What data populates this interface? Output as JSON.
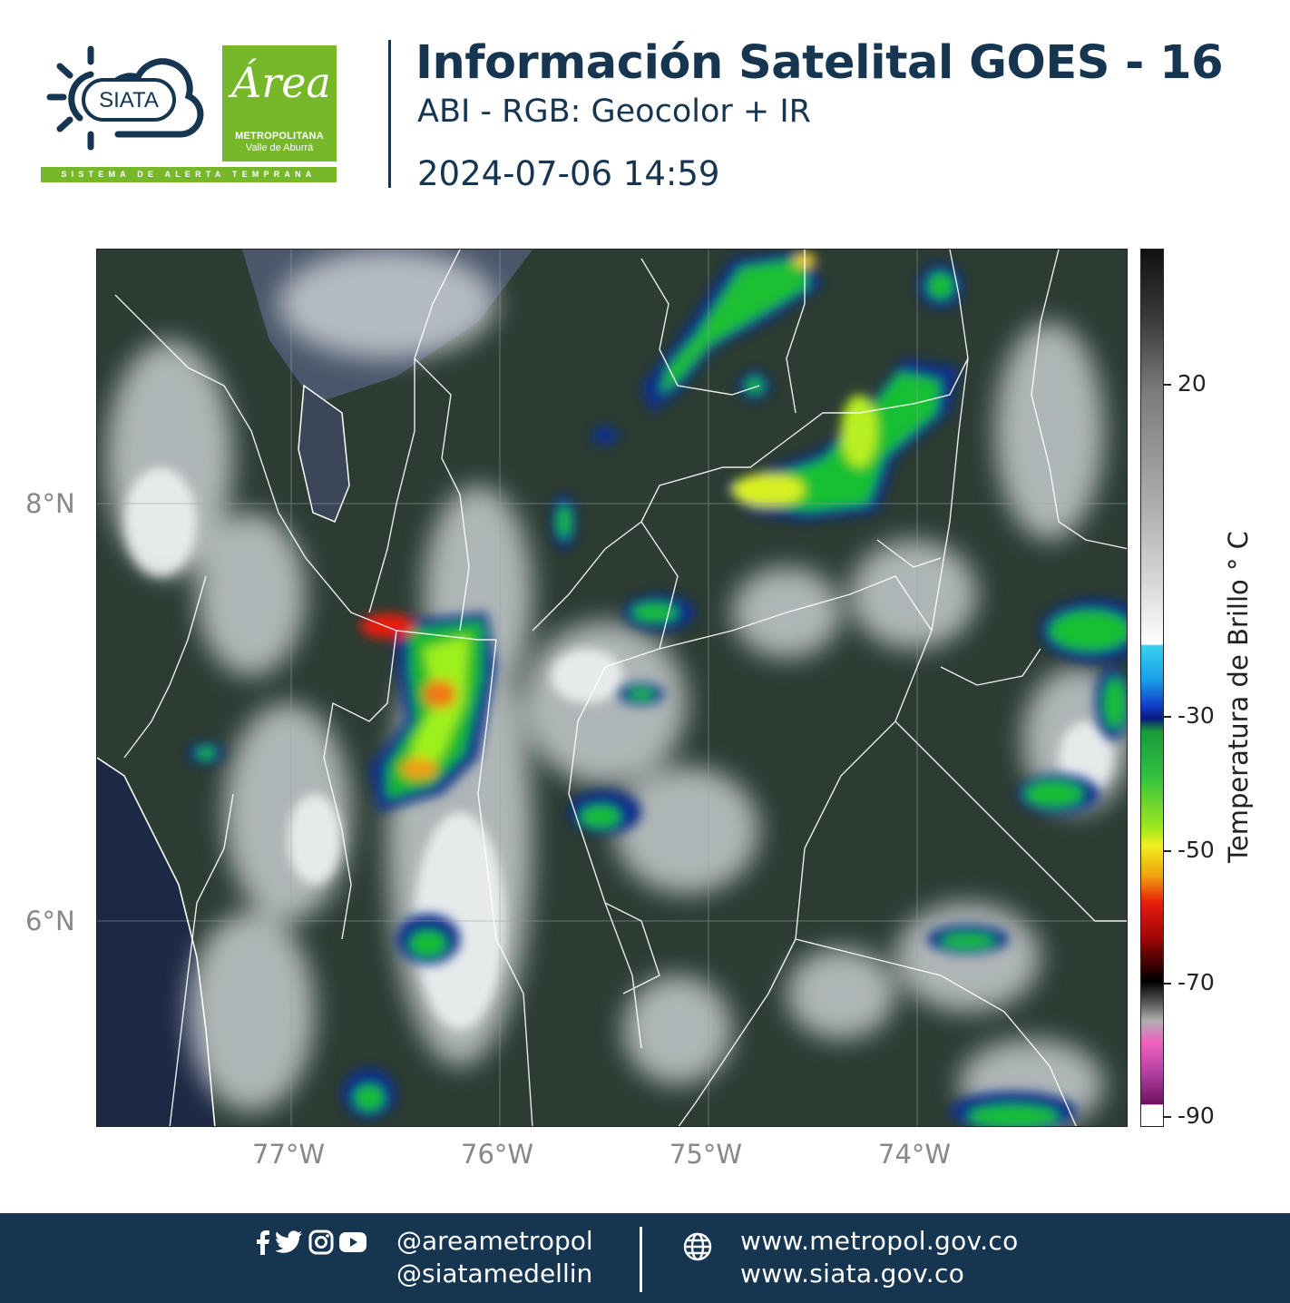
{
  "header": {
    "siata_logo_text": "SIATA",
    "siata_tagline": "SISTEMA DE ALERTA TEMPRANA",
    "area_logo_script": "Área",
    "area_logo_line1": "METROPOLITANA",
    "area_logo_line2": "Valle de Aburrá",
    "title": "Información Satelital GOES - 16",
    "subtitle": "ABI - RGB: Geocolor + IR",
    "datetime": "2024-07-06 14:59"
  },
  "map": {
    "latitude_labels": [
      "8°N",
      "6°N"
    ],
    "longitude_labels": [
      "77°W",
      "76°W",
      "75°W",
      "74°W"
    ],
    "colors": {
      "forest": "#24382a",
      "ocean": "#1d2844",
      "cloud": "#dfe3e6",
      "borders": "#ffffff"
    }
  },
  "colorbar": {
    "title": "Temperatura de Brillo ° C",
    "tick_labels": [
      "20",
      "-30",
      "-50",
      "-70",
      "-90"
    ],
    "range": [
      -90,
      40
    ]
  },
  "footer": {
    "social_icons": [
      "facebook-icon",
      "twitter-icon",
      "instagram-icon",
      "youtube-icon"
    ],
    "handle_1": "@areametropol",
    "handle_2": "@siatamedellin",
    "site_1": "www.metropol.gov.co",
    "site_2": "www.siata.gov.co",
    "globe_icon": "globe-icon"
  }
}
